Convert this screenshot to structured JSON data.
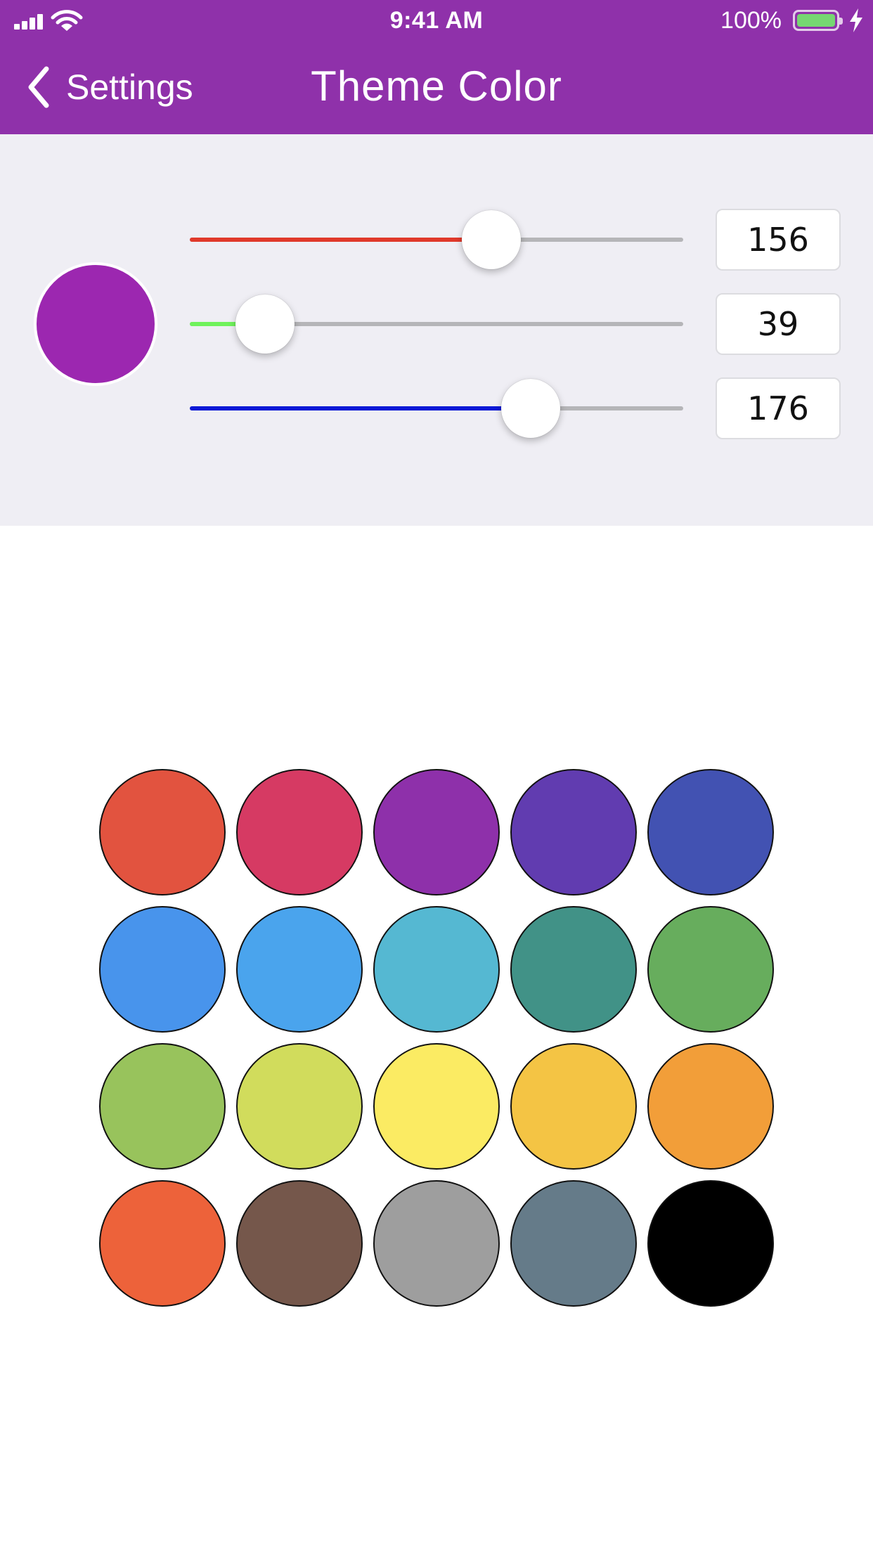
{
  "status_bar": {
    "time": "9:41 AM",
    "battery_percent": "100%",
    "battery_color": "#76d672"
  },
  "nav": {
    "back_label": "Settings",
    "back_icon": "chevron-left-icon",
    "title": "Theme Color",
    "background": "#8f31aa"
  },
  "editor": {
    "preview_color": "#9c27b0",
    "red": {
      "value": "156",
      "fraction": 0.6118,
      "fill_color": "#e0392b"
    },
    "green": {
      "value": "39",
      "fraction": 0.1529,
      "fill_color": "#6ff25b"
    },
    "blue": {
      "value": "176",
      "fraction": 0.6902,
      "fill_color": "#0a18d6"
    }
  },
  "palette": [
    "#e2533f",
    "#d63a63",
    "#8e30aa",
    "#613cb0",
    "#4252b2",
    "#4894ec",
    "#4aa4ed",
    "#55b8d2",
    "#419287",
    "#67ad5d",
    "#98c35c",
    "#d1dc5c",
    "#fbeb63",
    "#f4c444",
    "#f29e39",
    "#ed623a",
    "#75574b",
    "#9e9e9e",
    "#657b89",
    "#000000"
  ]
}
